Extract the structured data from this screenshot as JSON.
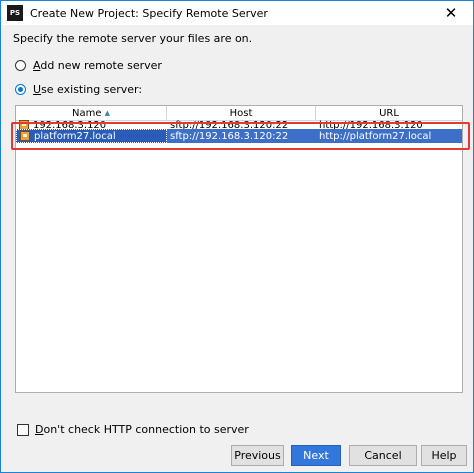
{
  "window": {
    "title": "Create New Project: Specify Remote Server",
    "app_icon_text": "PS",
    "close_glyph": "✕"
  },
  "instruction": "Specify the remote server your files are on.",
  "options": {
    "add_new_prefix": "",
    "add_new_mnemonic": "A",
    "add_new_rest": "dd new remote server",
    "use_existing_mnemonic": "U",
    "use_existing_rest": "se existing server:",
    "selected": "use_existing"
  },
  "table": {
    "columns": [
      "Name",
      "Host",
      "URL"
    ],
    "sort_indicator": "▲",
    "rows": [
      {
        "name": "192.168.3.120",
        "host": "sftp://192.168.3.120:22",
        "url": "http://192.168.3.120",
        "selected": false
      },
      {
        "name": "platform27.local",
        "host": "sftp://192.168.3.120:22",
        "url": "http://platform27.local",
        "selected": true
      }
    ]
  },
  "checkbox": {
    "mnemonic": "D",
    "rest": "on't check HTTP connection to server",
    "checked": false
  },
  "buttons": {
    "previous": "Previous",
    "next": "Next",
    "cancel": "Cancel",
    "help": "Help"
  },
  "colors": {
    "selection": "#3d6fc9",
    "highlight_box": "#e53935",
    "primary_button": "#3377dd",
    "window_border": "#1883d7"
  }
}
